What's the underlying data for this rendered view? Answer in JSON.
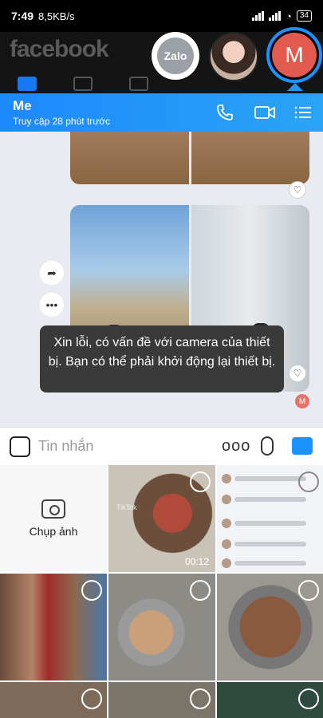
{
  "status_bar": {
    "time": "7:49",
    "speed": "8,5KB/s",
    "battery": "34"
  },
  "facebook": {
    "logo": "facebook"
  },
  "chat_heads": {
    "zalo_label": "Zalo",
    "active_initial": "M"
  },
  "conversation": {
    "name": "Me",
    "last_seen": "Truy cập 28 phút trước",
    "icons": [
      "phone-icon",
      "video-call-icon",
      "menu-icon"
    ]
  },
  "messages": {
    "toast": "Xin lỗi, có vấn đề với camera của thiết bị. Bạn có thể phải khởi động lại thiết bị.",
    "sender_initial": "M",
    "heart_glyph": "♡",
    "share_glyph": "➦",
    "more_glyph": "•••"
  },
  "input": {
    "placeholder": "Tin nhắn",
    "more_glyph": "ooo"
  },
  "gallery": {
    "camera_label": "Chụp ảnh",
    "video_duration": "00:12",
    "tiktok_text": "TikTok"
  },
  "colors": {
    "accent": "#1b93ff",
    "header_start": "#1e88ff",
    "toast_bg": "#3a3a3a",
    "avatar": "#e25a4e"
  }
}
